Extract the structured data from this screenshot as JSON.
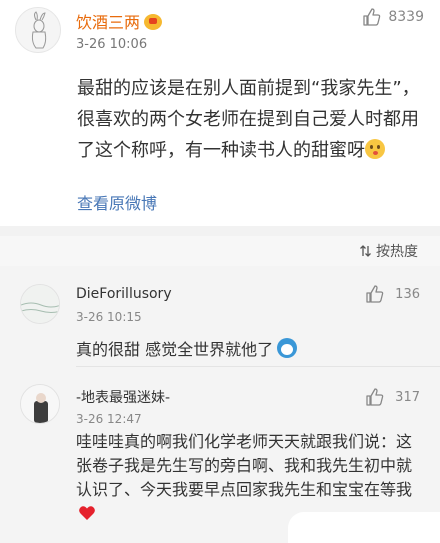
{
  "post": {
    "author": "饮酒三两",
    "time": "3-26 10:06",
    "likes": "8339",
    "content": "最甜的应该是在别人面前提到“我家先生”，很喜欢的两个女老师在提到自己爱人时都用了这个称呼，有一种读书人的甜蜜呀",
    "view_original": "查看原微博"
  },
  "sort": {
    "label": "按热度"
  },
  "comments": [
    {
      "name": "DieForillusory",
      "time": "3-26 10:15",
      "likes": "136",
      "text": "真的很甜 感觉全世界就他了"
    },
    {
      "name": "-地表最强迷妹-",
      "time": "3-26 12:47",
      "likes": "317",
      "text": "哇哇哇真的啊我们化学老师天天就跟我们说：这张卷子我是先生写的旁白啊、我和我先生初中就认识了、今天我要早点回家我先生和宝宝在等我"
    }
  ],
  "colors": {
    "author": "#e86b0c",
    "link": "#4877b6",
    "background": "#f4f4f4"
  }
}
